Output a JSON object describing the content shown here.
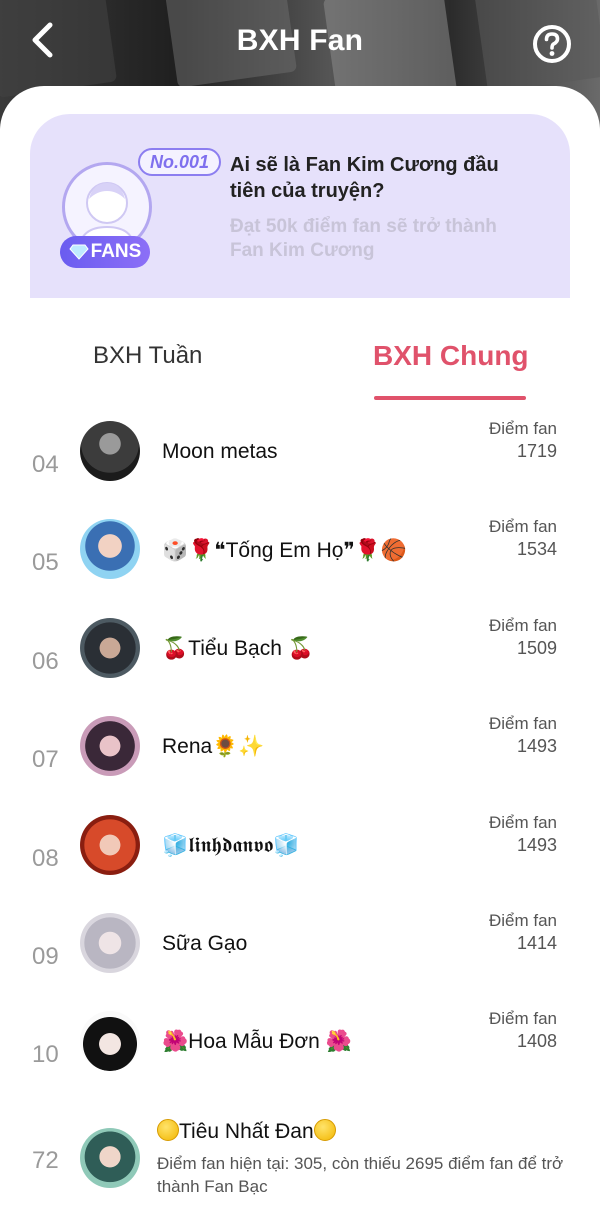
{
  "header": {
    "title": "BXH Fan"
  },
  "banner": {
    "rank_tag": "No.001",
    "badge_label": "FANS",
    "title": "Ai sẽ là Fan Kim Cương đầu tiên của truyện?",
    "subtitle": "Đạt 50k điểm fan sẽ trở thành Fan Kim Cương"
  },
  "tabs": [
    {
      "label": "BXH Tuần",
      "active": false
    },
    {
      "label": "BXH Chung",
      "active": true
    }
  ],
  "leaderboard": [
    {
      "rank": "04",
      "name": "Moon metas",
      "score_label": "Điểm fan",
      "score": "1719"
    },
    {
      "rank": "05",
      "name": "🎲🌹❝Tống Em Họ❞🌹🏀",
      "score_label": "Điểm fan",
      "score": "1534"
    },
    {
      "rank": "06",
      "name": "🍒Tiểu Bạch 🍒",
      "score_label": "Điểm fan",
      "score": "1509"
    },
    {
      "rank": "07",
      "name": "Rena🌻✨",
      "score_label": "Điểm fan",
      "score": "1493"
    },
    {
      "rank": "08",
      "name": "🧊𝖑𝖎𝖓𝖍𝖉𝖆𝖓𝖛𝖔🧊",
      "score_label": "Điểm fan",
      "score": "1493"
    },
    {
      "rank": "09",
      "name": "Sữa Gạo",
      "score_label": "Điểm fan",
      "score": "1414"
    },
    {
      "rank": "10",
      "name": "🌺Hoa Mẫu Đơn 🌺",
      "score_label": "Điểm fan",
      "score": "1408"
    }
  ],
  "current_user": {
    "rank": "72",
    "name": "Tiêu Nhất Đan",
    "info": "Điểm fan hiện tại: 305, còn thiếu 2695 điểm fan để trở thành Fan Bạc"
  },
  "colors": {
    "accent": "#e0526b",
    "banner_bg": "#e6e1fb",
    "badge": "#7f70ee"
  }
}
